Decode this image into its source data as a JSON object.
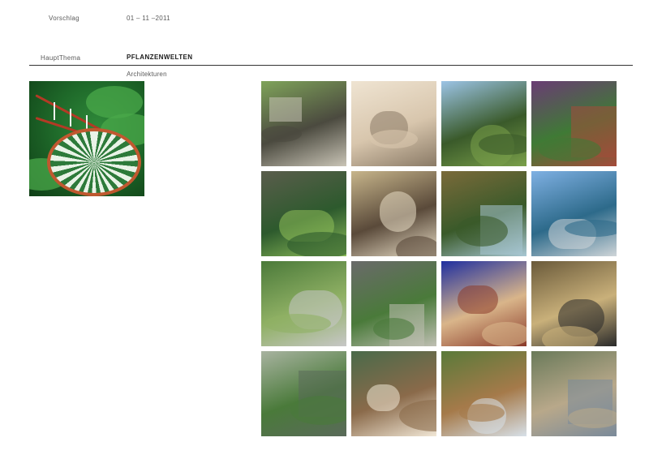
{
  "header": {
    "label_proposal": "Vorschlag",
    "date": "01 – 11 –2011",
    "label_theme": "HauptThema",
    "theme": "PFLANZENWELTEN",
    "subtheme": "Architekturen"
  },
  "hero_image": {
    "colors": {
      "sky": "#1f6a2a",
      "leaf": "#4aa84a",
      "rail": "#b33a25",
      "stair": "#e9f3e7"
    }
  },
  "gallery": {
    "tiles": [
      {
        "colors": [
          "#7fa35a",
          "#4b4a3f",
          "#c9c4b6"
        ]
      },
      {
        "colors": [
          "#efe4d2",
          "#d8c6ad",
          "#8a7a66"
        ]
      },
      {
        "colors": [
          "#9cc4e6",
          "#3a5a2a",
          "#7aa04a"
        ]
      },
      {
        "colors": [
          "#6a3c74",
          "#3f7a35",
          "#a54a3a"
        ]
      },
      {
        "colors": [
          "#5a5d4c",
          "#2d5a2d",
          "#8fbf5a"
        ]
      },
      {
        "colors": [
          "#c7b58b",
          "#5a4a3a",
          "#e7dcc5"
        ]
      },
      {
        "colors": [
          "#7a6a3a",
          "#3a5a2a",
          "#a8c7d4"
        ]
      },
      {
        "colors": [
          "#7fb0e3",
          "#2d6a8a",
          "#cfd5d8"
        ]
      },
      {
        "colors": [
          "#4b7a3a",
          "#8fb064",
          "#c7c7c7"
        ]
      },
      {
        "colors": [
          "#6a6a6a",
          "#4a7a3a",
          "#bfbfb3"
        ]
      },
      {
        "colors": [
          "#1f2fa0",
          "#d9b58a",
          "#8a3a2a"
        ]
      },
      {
        "colors": [
          "#6a5a3a",
          "#c9b07a",
          "#2a2a2a"
        ]
      },
      {
        "colors": [
          "#a8b3a0",
          "#4a7a3a",
          "#5a6a5a"
        ]
      },
      {
        "colors": [
          "#4a6a4a",
          "#8a6a4a",
          "#f1e7d6"
        ]
      },
      {
        "colors": [
          "#5a7a3a",
          "#a57a4a",
          "#d7e0e8"
        ]
      },
      {
        "colors": [
          "#6a7a5a",
          "#b8a88a",
          "#7a8a9a"
        ]
      }
    ]
  }
}
